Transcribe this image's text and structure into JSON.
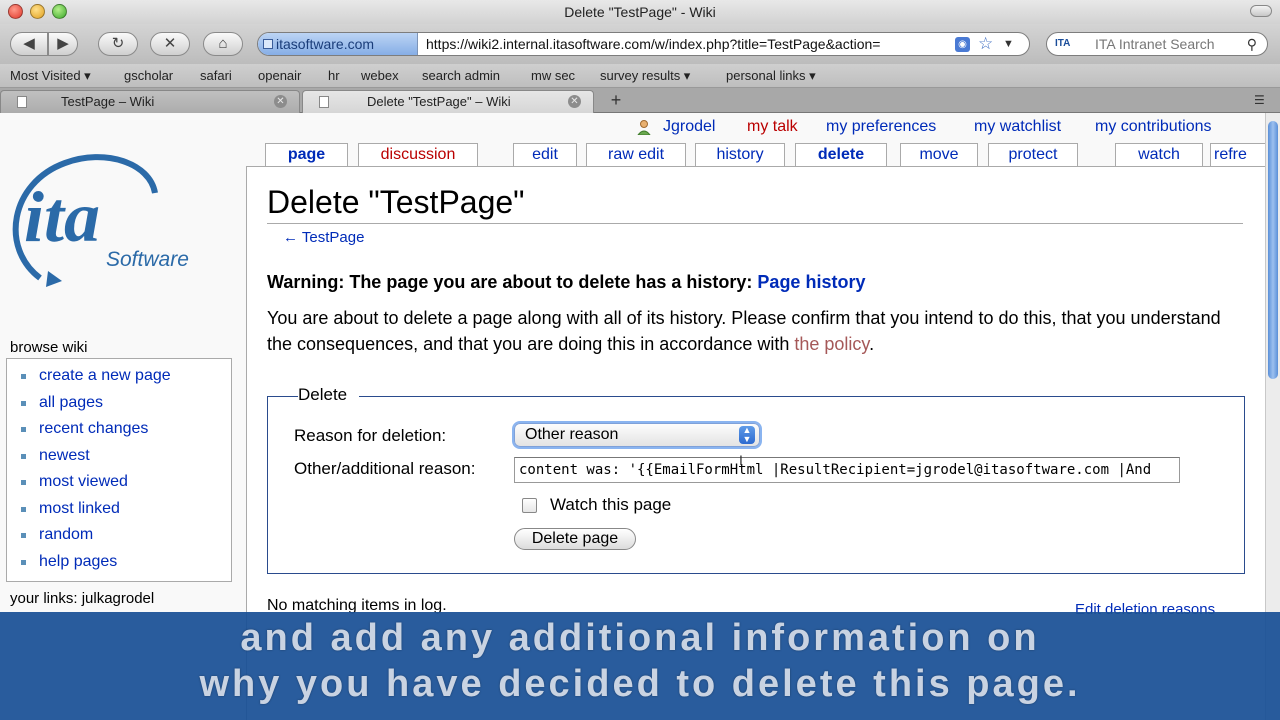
{
  "window": {
    "title": "Delete \"TestPage\" - Wiki"
  },
  "toolbar": {
    "site_identity": "itasoftware.com",
    "url": "https://wiki2.internal.itasoftware.com/w/index.php?title=TestPage&action=",
    "search_placeholder": "ITA Intranet Search",
    "search_engine_label": "ITA"
  },
  "bookmarks": [
    "Most Visited ▾",
    "gscholar",
    "safari",
    "openair",
    "hr",
    "webex",
    "search admin",
    "mw sec",
    "survey results ▾",
    "personal links ▾"
  ],
  "tabs": [
    {
      "label": "TestPage – Wiki"
    },
    {
      "label": "Delete \"TestPage\" – Wiki"
    }
  ],
  "personal": {
    "user": "Jgrodel",
    "talk": "my talk",
    "prefs": "my preferences",
    "watchlist": "my watchlist",
    "contribs": "my contributions"
  },
  "content_tabs": [
    "page",
    "discussion",
    "edit",
    "raw edit",
    "history",
    "delete",
    "move",
    "protect",
    "watch",
    "refre"
  ],
  "logo": {
    "main": "ita",
    "sub": "Software"
  },
  "sidebar": {
    "heading": "browse wiki",
    "items": [
      "create a new page",
      "all pages",
      "recent changes",
      "newest",
      "most viewed",
      "most linked",
      "random",
      "help pages"
    ],
    "your_links": "your links: julkagrodel"
  },
  "page": {
    "heading": "Delete \"TestPage\"",
    "backlink": "← TestPage",
    "warning": "Warning: The page you are about to delete has a history:",
    "history_link": "Page history",
    "intro": "You are about to delete a page along with all of its history. Please confirm that you intend to do this, that you understand the consequences, and that you are doing this in accordance with",
    "policy_link": "the policy",
    "intro_end": "."
  },
  "form": {
    "legend": "Delete",
    "reason_label": "Reason for deletion:",
    "reason_value": "Other reason",
    "other_label": "Other/additional reason:",
    "other_value": "content was: '{{EmailFormHtml |ResultRecipient=jgrodel@itasoftware.com |And",
    "watch_label": "Watch this page",
    "watch_checked": false,
    "submit": "Delete page"
  },
  "log": {
    "no_match": "No matching items in log.",
    "edit_reasons": "Edit deletion reasons"
  },
  "caption": {
    "line1": "and add any additional information on",
    "line2": "why you have decided to delete this page."
  },
  "colors": {
    "link": "#002bb8",
    "policy_link": "#a55858",
    "tab_accent": "#fabd23",
    "caption_bg": "#1950a0"
  }
}
